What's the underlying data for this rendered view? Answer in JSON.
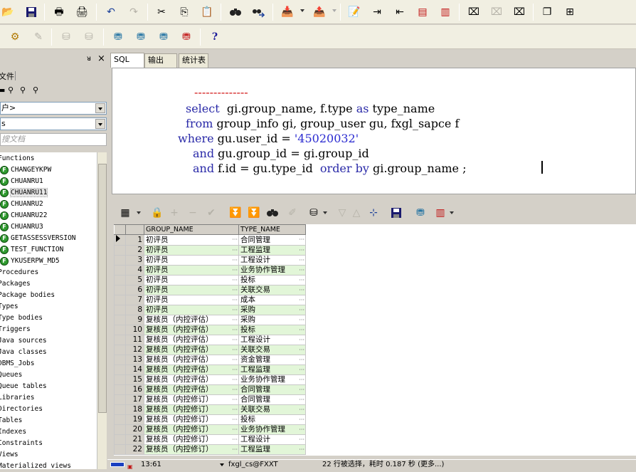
{
  "toolbar1": {
    "buttons": [
      "open-folder",
      "save",
      "print",
      "print-preview",
      "undo",
      "redo",
      "cut",
      "copy",
      "paste",
      "find",
      "find-next",
      "import",
      "export",
      "comment",
      "indent",
      "unindent",
      "uppercase",
      "lowercase",
      "debug-step",
      "debug-step-disabled",
      "debug-run",
      "window-list",
      "layout"
    ]
  },
  "left_panel": {
    "pin_glyph": "ᴚ",
    "close_glyph": "×",
    "filter_label": "文件",
    "combo_owner": "户>",
    "combo_type": "s",
    "search_placeholder": "搜文档",
    "tree": [
      {
        "label": "Functions",
        "icon": false,
        "indent": 0
      },
      {
        "label": "CHANGEYKPW",
        "icon": true,
        "indent": 1
      },
      {
        "label": "CHUANRU1",
        "icon": true,
        "indent": 1
      },
      {
        "label": "CHUANRU11",
        "icon": true,
        "indent": 1,
        "selected": true
      },
      {
        "label": "CHUANRU2",
        "icon": true,
        "indent": 1
      },
      {
        "label": "CHUANRU22",
        "icon": true,
        "indent": 1
      },
      {
        "label": "CHUANRU3",
        "icon": true,
        "indent": 1
      },
      {
        "label": "GETASSESSVERSION",
        "icon": true,
        "indent": 1
      },
      {
        "label": "TEST_FUNCTION",
        "icon": true,
        "indent": 1
      },
      {
        "label": "YKUSERPW_MD5",
        "icon": true,
        "indent": 1
      },
      {
        "label": "Procedures",
        "icon": false,
        "indent": 0
      },
      {
        "label": "Packages",
        "icon": false,
        "indent": 0
      },
      {
        "label": "Package bodies",
        "icon": false,
        "indent": 0
      },
      {
        "label": "Types",
        "icon": false,
        "indent": 0
      },
      {
        "label": "Type bodies",
        "icon": false,
        "indent": 0
      },
      {
        "label": "Triggers",
        "icon": false,
        "indent": 0
      },
      {
        "label": "Java sources",
        "icon": false,
        "indent": 0
      },
      {
        "label": "Java classes",
        "icon": false,
        "indent": 0
      },
      {
        "label": "DBMS_Jobs",
        "icon": false,
        "indent": 0
      },
      {
        "label": "Queues",
        "icon": false,
        "indent": 0
      },
      {
        "label": "Queue tables",
        "icon": false,
        "indent": 0
      },
      {
        "label": "Libraries",
        "icon": false,
        "indent": 0
      },
      {
        "label": "Directories",
        "icon": false,
        "indent": 0
      },
      {
        "label": "Tables",
        "icon": false,
        "indent": 0
      },
      {
        "label": "Indexes",
        "icon": false,
        "indent": 0
      },
      {
        "label": "Constraints",
        "icon": false,
        "indent": 0
      },
      {
        "label": "Views",
        "icon": false,
        "indent": 0
      },
      {
        "label": "Materialized views",
        "icon": false,
        "indent": 0
      }
    ]
  },
  "tabs": [
    {
      "label": "SQL",
      "active": true
    },
    {
      "label": "输出",
      "active": false
    },
    {
      "label": "统计表",
      "active": false
    }
  ],
  "editor": {
    "comment_line": "--------------",
    "line1_kw": "select",
    "line1_rest": "  gi.group_name, f.type ",
    "line1_as": "as",
    "line1_tail": " type_name",
    "line2_kw": "from",
    "line2_rest": " group_info gi, group_user gu, fxgl_sapce f",
    "line3_kw": "where",
    "line3_rest": " gu.user_id = ",
    "line3_str": "'45020032'",
    "line4_kw": "and",
    "line4_rest": " gu.group_id = gi.group_id",
    "line5_kw": "and",
    "line5_rest": " f.id = gu.type_id  ",
    "line5_kw2": "order by",
    "line5_tail": " gi.group_name ;"
  },
  "results": {
    "columns": [
      "GROUP_NAME",
      "TYPE_NAME"
    ],
    "rows": [
      [
        "1",
        "初评员",
        "合同管理"
      ],
      [
        "2",
        "初评员",
        "工程监理"
      ],
      [
        "3",
        "初评员",
        "工程设计"
      ],
      [
        "4",
        "初评员",
        "业务协作管理"
      ],
      [
        "5",
        "初评员",
        "投标"
      ],
      [
        "6",
        "初评员",
        "关联交易"
      ],
      [
        "7",
        "初评员",
        "成本"
      ],
      [
        "8",
        "初评员",
        "采购"
      ],
      [
        "9",
        "复核员（内控评估）",
        "采购"
      ],
      [
        "10",
        "复核员（内控评估）",
        "投标"
      ],
      [
        "11",
        "复核员（内控评估）",
        "工程设计"
      ],
      [
        "12",
        "复核员（内控评估）",
        "关联交易"
      ],
      [
        "13",
        "复核员（内控评估）",
        "资金管理"
      ],
      [
        "14",
        "复核员（内控评估）",
        "工程监理"
      ],
      [
        "15",
        "复核员（内控评估）",
        "业务协作管理"
      ],
      [
        "16",
        "复核员（内控评估）",
        "合同管理"
      ],
      [
        "17",
        "复核员（内控修订）",
        "合同管理"
      ],
      [
        "18",
        "复核员（内控修订）",
        "关联交易"
      ],
      [
        "19",
        "复核员（内控修订）",
        "投标"
      ],
      [
        "20",
        "复核员（内控修订）",
        "业务协作管理"
      ],
      [
        "21",
        "复核员（内控修订）",
        "工程设计"
      ],
      [
        "22",
        "复核员（内控修订）",
        "工程监理"
      ]
    ]
  },
  "status": {
    "position": "13:61",
    "connection": "fxgl_cs@FXXT",
    "message": "22 行被选择，耗时 0.187 秒 (更多...)"
  }
}
